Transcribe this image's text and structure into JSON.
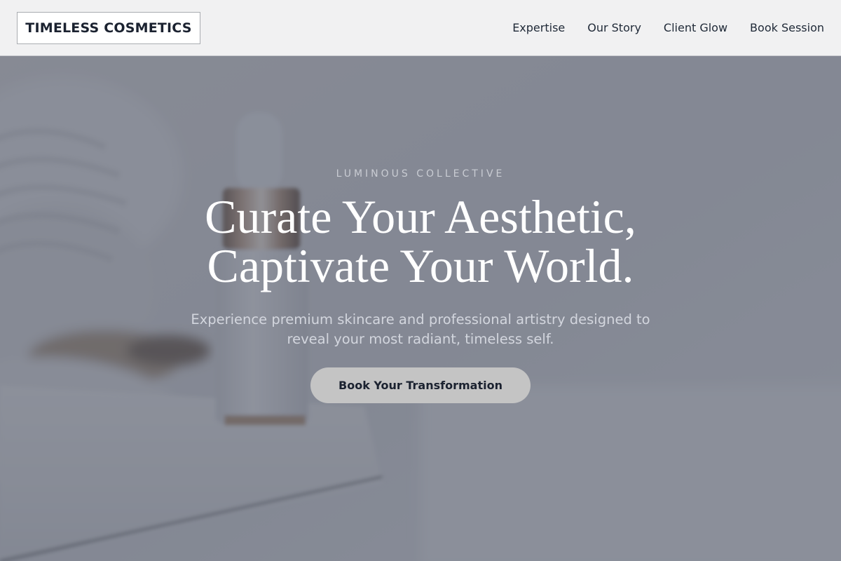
{
  "header": {
    "logo": "TIMELESS COSMETICS",
    "nav": [
      {
        "label": "Expertise"
      },
      {
        "label": "Our Story"
      },
      {
        "label": "Client Glow"
      },
      {
        "label": "Book Session"
      }
    ]
  },
  "hero": {
    "eyebrow": "LUMINOUS COLLECTIVE",
    "headline_line1": "Curate Your Aesthetic,",
    "headline_line2": "Captivate Your World.",
    "subhead": "Experience premium skincare and professional artistry designed to reveal your most radiant, timeless self.",
    "cta_label": "Book Your Transformation",
    "background_image": "serum-dropper-bottle-on-marble-tray"
  },
  "colors": {
    "header_bg": "#f1f1f2",
    "overlay": "#4e5464",
    "cta_bg": "#c4c4c4",
    "text_dark": "#1b2230"
  }
}
